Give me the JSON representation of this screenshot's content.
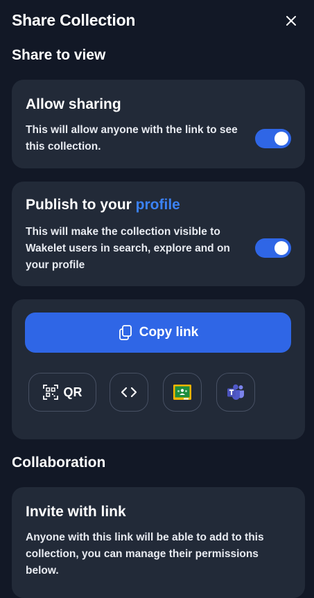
{
  "header": {
    "title": "Share Collection",
    "close_icon": "close-icon"
  },
  "share_to_view": {
    "heading": "Share to view",
    "allow_sharing": {
      "title": "Allow sharing",
      "description_line1": "This will allow anyone with the link to see",
      "description_line2": "this collection.",
      "enabled": true
    },
    "publish": {
      "title_prefix": "Publish to your ",
      "title_link": "profile",
      "description_line1": "This will make the collection visible to",
      "description_line2": "Wakelet users in search, explore and on",
      "description_line3": "your profile",
      "enabled": true
    },
    "copy_link": {
      "label": "Copy link",
      "icon": "copy-icon"
    },
    "share_options": [
      {
        "name": "qr-code",
        "label": "QR",
        "icon": "qr-code-icon"
      },
      {
        "name": "embed",
        "icon": "code-icon"
      },
      {
        "name": "google-classroom",
        "icon": "google-classroom-icon"
      },
      {
        "name": "microsoft-teams",
        "icon": "microsoft-teams-icon"
      }
    ]
  },
  "collaboration": {
    "heading": "Collaboration",
    "invite": {
      "title": "Invite with link",
      "description_line1": "Anyone with this link will be able to add to this",
      "description_line2": "collection, you can manage their permissions",
      "description_line3": "below."
    }
  },
  "colors": {
    "background": "#121826",
    "card": "#222a38",
    "accent": "#2f66e6",
    "link": "#3b82f6"
  }
}
